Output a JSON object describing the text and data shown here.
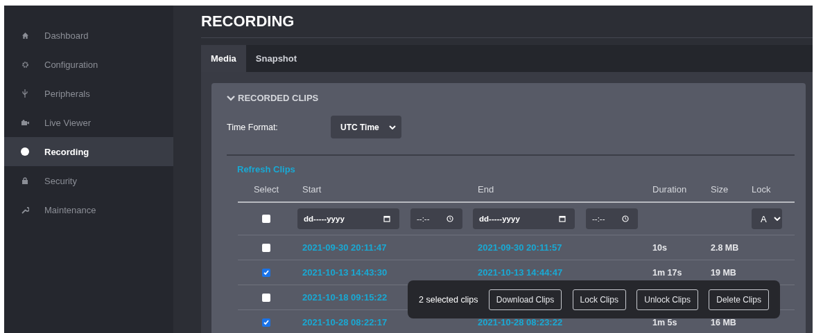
{
  "sidebar": {
    "items": [
      {
        "label": "Dashboard",
        "selected": false
      },
      {
        "label": "Configuration",
        "selected": false
      },
      {
        "label": "Peripherals",
        "selected": false
      },
      {
        "label": "Live Viewer",
        "selected": false
      },
      {
        "label": "Recording",
        "selected": true
      },
      {
        "label": "Security",
        "selected": false
      },
      {
        "label": "Maintenance",
        "selected": false
      }
    ]
  },
  "page_title": "RECORDING",
  "tabs": [
    {
      "label": "Media",
      "selected": true
    },
    {
      "label": "Snapshot",
      "selected": false
    }
  ],
  "section": {
    "title": "RECORDED CLIPS",
    "expanded": true
  },
  "time_format": {
    "label": "Time Format:",
    "value": "UTC Time"
  },
  "refresh_link": "Refresh Clips",
  "table": {
    "columns": [
      "Select",
      "Start",
      "End",
      "Duration",
      "Size",
      "Lock"
    ],
    "filters": {
      "checked": false,
      "start_date": {
        "placeholder": "dd-----yyyy"
      },
      "start_time": {
        "placeholder": "--:--"
      },
      "end_date": {
        "placeholder": "dd-----yyyy"
      },
      "end_time": {
        "placeholder": "--:--"
      },
      "lock": "A"
    },
    "rows": [
      {
        "checked": false,
        "start": "2021-09-30 20:11:47",
        "end": "2021-09-30 20:11:57",
        "duration": "10s",
        "size": "2.8 MB"
      },
      {
        "checked": true,
        "start": "2021-10-13 14:43:30",
        "end": "2021-10-13 14:44:47",
        "duration": "1m 17s",
        "size": "19 MB"
      },
      {
        "checked": false,
        "start": "2021-10-18 09:15:22"
      },
      {
        "checked": true,
        "start": "2021-10-28 08:22:17",
        "end": "2021-10-28 08:23:22",
        "duration": "1m 5s",
        "size": "16 MB"
      }
    ]
  },
  "selection_bar": {
    "count_text": "2 selected clips",
    "buttons": [
      "Download Clips",
      "Lock Clips",
      "Unlock Clips",
      "Delete Clips"
    ]
  }
}
